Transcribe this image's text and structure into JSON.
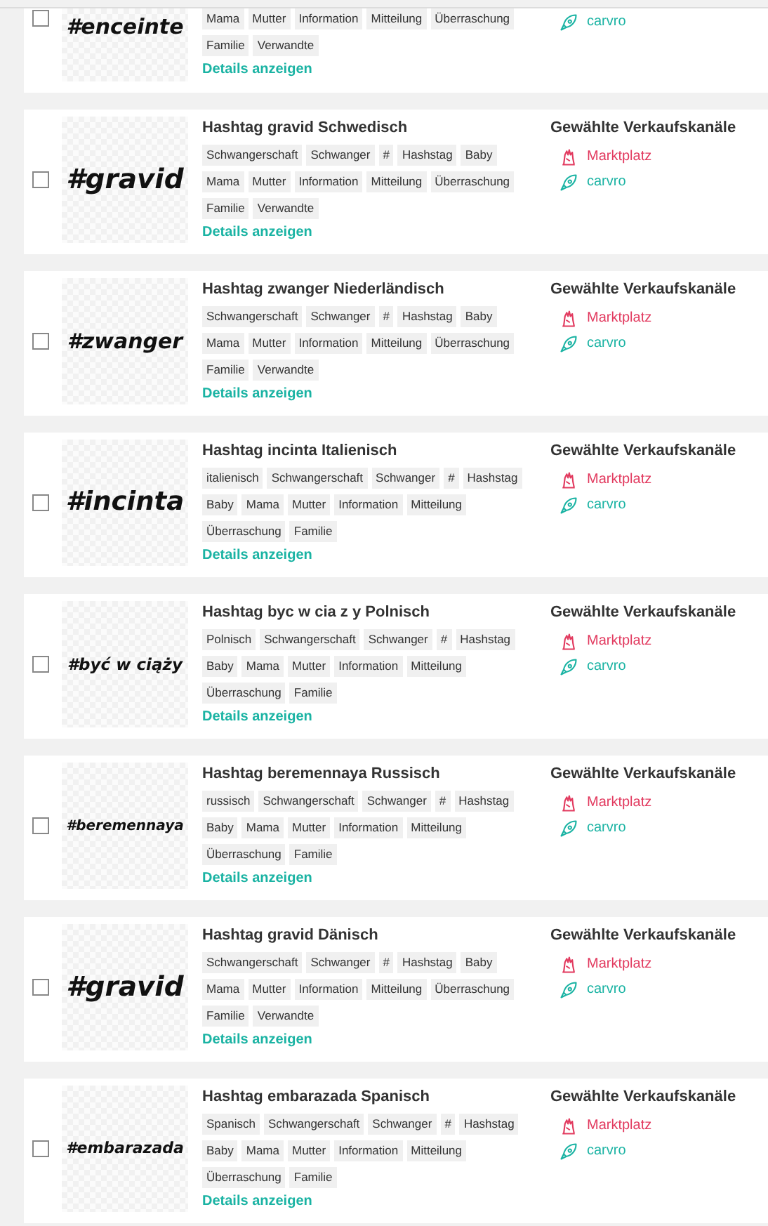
{
  "products": [
    {
      "partial": true,
      "hashtag": "#enceinte",
      "selected": false,
      "tags": [
        "Mama",
        "Mutter",
        "Information",
        "Mitteilung",
        "Überraschung",
        "Familie",
        "Verwandte"
      ],
      "details_link": "Details anzeigen",
      "channels": [
        {
          "name": "carvro",
          "kind": "rocket",
          "color": "#1ab3a3"
        }
      ]
    },
    {
      "title": "Hashtag gravid Schwedisch",
      "hashtag": "#gravid",
      "selected": false,
      "tags": [
        "Schwangerschaft",
        "Schwanger",
        "#",
        "Hashstag",
        "Baby",
        "Mama",
        "Mutter",
        "Information",
        "Mitteilung",
        "Überraschung",
        "Familie",
        "Verwandte"
      ],
      "details_link": "Details anzeigen",
      "channels_heading": "Gewählte Verkaufskanäle",
      "channels": [
        {
          "name": "Marktplatz",
          "kind": "hand",
          "color": "#e23a5f"
        },
        {
          "name": "carvro",
          "kind": "rocket",
          "color": "#1ab3a3"
        }
      ]
    },
    {
      "title": "Hashtag zwanger Niederländisch",
      "hashtag": "#zwanger",
      "selected": false,
      "tags": [
        "Schwangerschaft",
        "Schwanger",
        "#",
        "Hashstag",
        "Baby",
        "Mama",
        "Mutter",
        "Information",
        "Mitteilung",
        "Überraschung",
        "Familie",
        "Verwandte"
      ],
      "details_link": "Details anzeigen",
      "channels_heading": "Gewählte Verkaufskanäle",
      "channels": [
        {
          "name": "Marktplatz",
          "kind": "hand",
          "color": "#e23a5f"
        },
        {
          "name": "carvro",
          "kind": "rocket",
          "color": "#1ab3a3"
        }
      ]
    },
    {
      "title": "Hashtag incinta Italienisch",
      "hashtag": "#incinta",
      "selected": false,
      "tags": [
        "italienisch",
        "Schwangerschaft",
        "Schwanger",
        "#",
        "Hashstag",
        "Baby",
        "Mama",
        "Mutter",
        "Information",
        "Mitteilung",
        "Überraschung",
        "Familie"
      ],
      "details_link": "Details anzeigen",
      "channels_heading": "Gewählte Verkaufskanäle",
      "channels": [
        {
          "name": "Marktplatz",
          "kind": "hand",
          "color": "#e23a5f"
        },
        {
          "name": "carvro",
          "kind": "rocket",
          "color": "#1ab3a3"
        }
      ]
    },
    {
      "title": "Hashtag byc w cia z y Polnisch",
      "hashtag": "#być w ciąży",
      "selected": false,
      "tags": [
        "Polnisch",
        "Schwangerschaft",
        "Schwanger",
        "#",
        "Hashstag",
        "Baby",
        "Mama",
        "Mutter",
        "Information",
        "Mitteilung",
        "Überraschung",
        "Familie"
      ],
      "details_link": "Details anzeigen",
      "channels_heading": "Gewählte Verkaufskanäle",
      "channels": [
        {
          "name": "Marktplatz",
          "kind": "hand",
          "color": "#e23a5f"
        },
        {
          "name": "carvro",
          "kind": "rocket",
          "color": "#1ab3a3"
        }
      ]
    },
    {
      "title": "Hashtag beremennaya Russisch",
      "hashtag": "#beremennaya",
      "selected": false,
      "tags": [
        "russisch",
        "Schwangerschaft",
        "Schwanger",
        "#",
        "Hashstag",
        "Baby",
        "Mama",
        "Mutter",
        "Information",
        "Mitteilung",
        "Überraschung",
        "Familie"
      ],
      "details_link": "Details anzeigen",
      "channels_heading": "Gewählte Verkaufskanäle",
      "channels": [
        {
          "name": "Marktplatz",
          "kind": "hand",
          "color": "#e23a5f"
        },
        {
          "name": "carvro",
          "kind": "rocket",
          "color": "#1ab3a3"
        }
      ]
    },
    {
      "title": "Hashtag gravid Dänisch",
      "hashtag": "#gravid",
      "selected": false,
      "tags": [
        "Schwangerschaft",
        "Schwanger",
        "#",
        "Hashstag",
        "Baby",
        "Mama",
        "Mutter",
        "Information",
        "Mitteilung",
        "Überraschung",
        "Familie",
        "Verwandte"
      ],
      "details_link": "Details anzeigen",
      "channels_heading": "Gewählte Verkaufskanäle",
      "channels": [
        {
          "name": "Marktplatz",
          "kind": "hand",
          "color": "#e23a5f"
        },
        {
          "name": "carvro",
          "kind": "rocket",
          "color": "#1ab3a3"
        }
      ]
    },
    {
      "title": "Hashtag embarazada Spanisch",
      "hashtag": "#embarazada",
      "selected": false,
      "tags": [
        "Spanisch",
        "Schwangerschaft",
        "Schwanger",
        "#",
        "Hashstag",
        "Baby",
        "Mama",
        "Mutter",
        "Information",
        "Mitteilung",
        "Überraschung",
        "Familie"
      ],
      "details_link": "Details anzeigen",
      "channels_heading": "Gewählte Verkaufskanäle",
      "channels": [
        {
          "name": "Marktplatz",
          "kind": "hand",
          "color": "#e23a5f"
        },
        {
          "name": "carvro",
          "kind": "rocket",
          "color": "#1ab3a3"
        }
      ]
    }
  ]
}
